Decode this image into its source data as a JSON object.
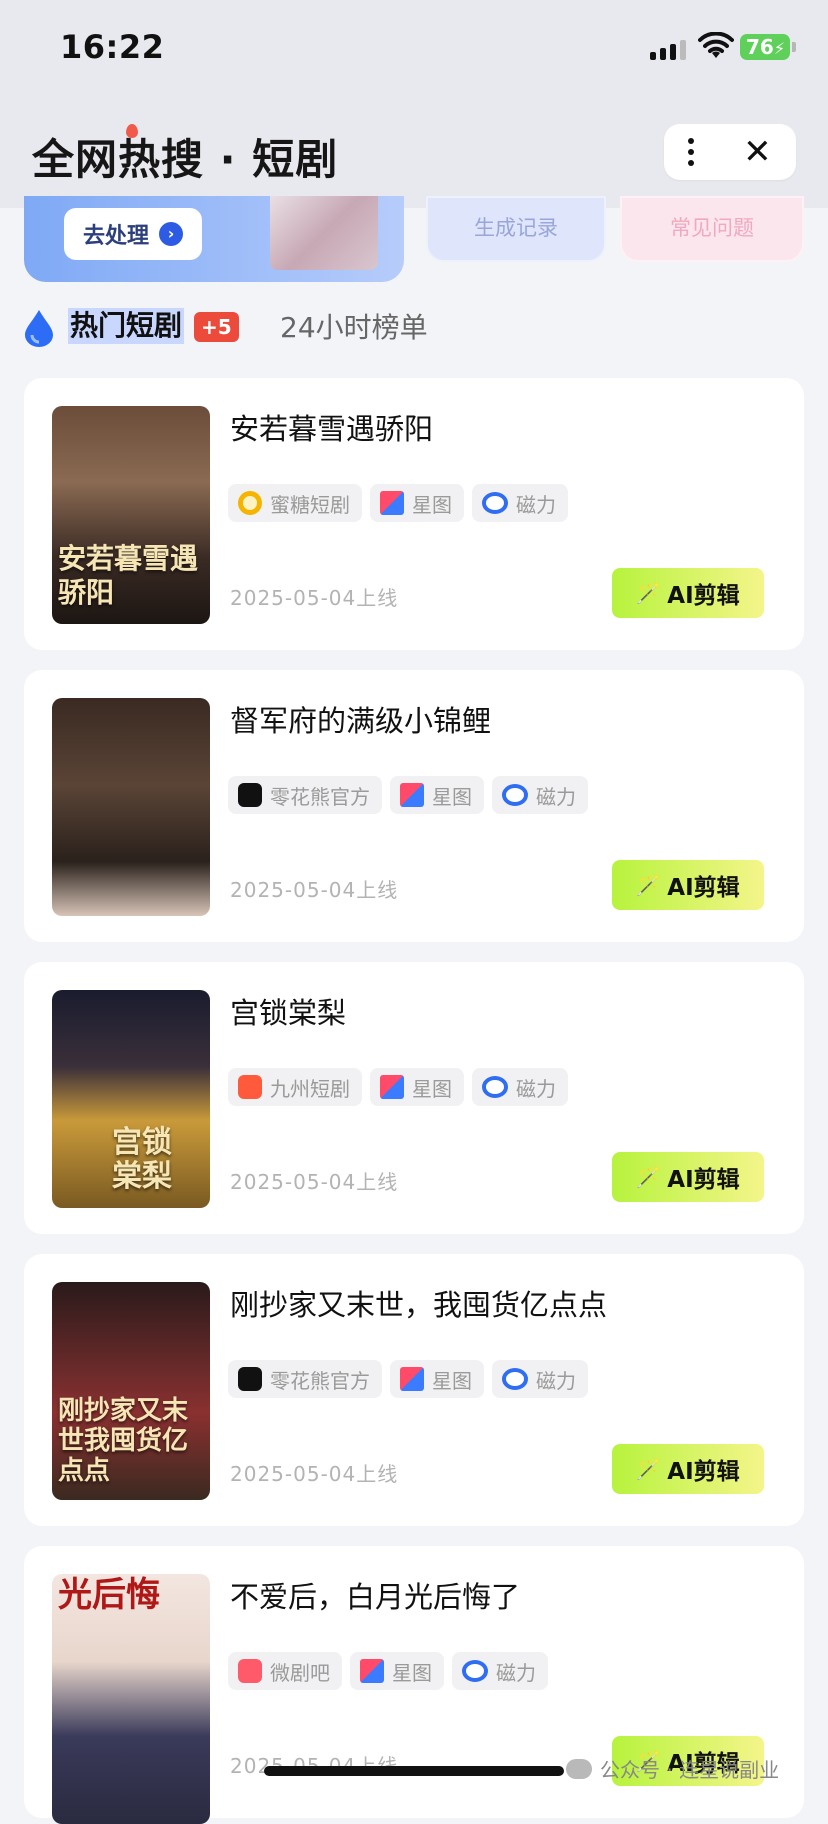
{
  "status_bar": {
    "time": "16:22",
    "battery": "76"
  },
  "header": {
    "title": "全网热搜 · 短剧",
    "more_icon": "more-vertical-icon",
    "close_icon": "close-icon"
  },
  "banners": {
    "process_label": "去处理",
    "record_label": "生成记录",
    "faq_label": "常见问题"
  },
  "tabs": {
    "hot_label": "热门短剧",
    "hot_badge": "+5",
    "rank_label": "24小时榜单",
    "accent": "#2d6df6"
  },
  "cards": [
    {
      "title": "安若暮雪遇骄阳",
      "poster_text": "安若暮雪遇骄阳",
      "tags": [
        "蜜糖短剧",
        "星图",
        "磁力"
      ],
      "date": "2025-05-04上线",
      "action": "AI剪辑"
    },
    {
      "title": "督军府的满级小锦鲤",
      "poster_text": "",
      "tags": [
        "零花熊官方",
        "星图",
        "磁力"
      ],
      "date": "2025-05-04上线",
      "action": "AI剪辑"
    },
    {
      "title": "宫锁棠梨",
      "poster_text": "宫锁棠梨",
      "tags": [
        "九州短剧",
        "星图",
        "磁力"
      ],
      "date": "2025-05-04上线",
      "action": "AI剪辑"
    },
    {
      "title": "刚抄家又末世，我囤货亿点点",
      "poster_text": "刚抄家又末世我囤货亿点点",
      "tags": [
        "零花熊官方",
        "星图",
        "磁力"
      ],
      "date": "2025-05-04上线",
      "action": "AI剪辑"
    },
    {
      "title": "不爱后，白月光后悔了",
      "poster_text": "光后悔",
      "tags": [
        "微剧吧",
        "星图",
        "磁力"
      ],
      "date": "2025-05-04上线",
      "action": "AI剪辑"
    }
  ],
  "watermark": "公众号 · 连星说副业"
}
